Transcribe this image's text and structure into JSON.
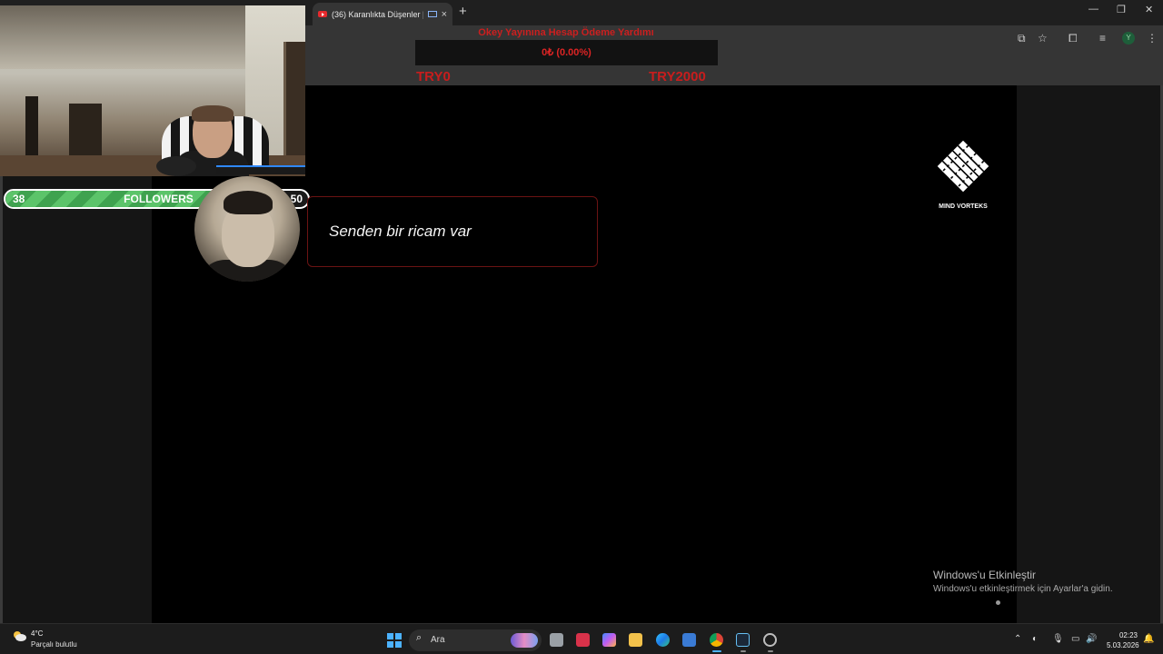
{
  "browser": {
    "tab_title": "(36) Karanlıkta Düşenler | Ç",
    "tab_close": "×",
    "new_tab": "+",
    "window_controls": [
      "—",
      "❐",
      "✕"
    ]
  },
  "donation_goal": {
    "title": "Okey Yayınına Hesap Ödeme Yardımı",
    "current": "0₺ (0.00%)",
    "progress_fraction": 0.0,
    "min_label": "TRY0",
    "max_label": "TRY2000"
  },
  "followers_goal": {
    "current": "38",
    "label": "FOLLOWERS",
    "goal": "50",
    "progress_fraction": 0.76
  },
  "dialogue": {
    "text": "Senden bir ricam var"
  },
  "logo": {
    "text": "MIND VORTEKS"
  },
  "activation": {
    "title": "Windows'u Etkinleştir",
    "subtitle": "Windows'u etkinleştirmek için Ayarlar'a gidin."
  },
  "taskbar": {
    "weather_temp": "4°C",
    "weather_desc": "Parçalı bulutlu",
    "search_placeholder": "Ara",
    "time": "02:23",
    "date": "5.03.2026"
  },
  "colors": {
    "goal_red": "#cc1f1f",
    "follower_green": "#5cc46a",
    "windows_blue": "#4cb2ff"
  }
}
